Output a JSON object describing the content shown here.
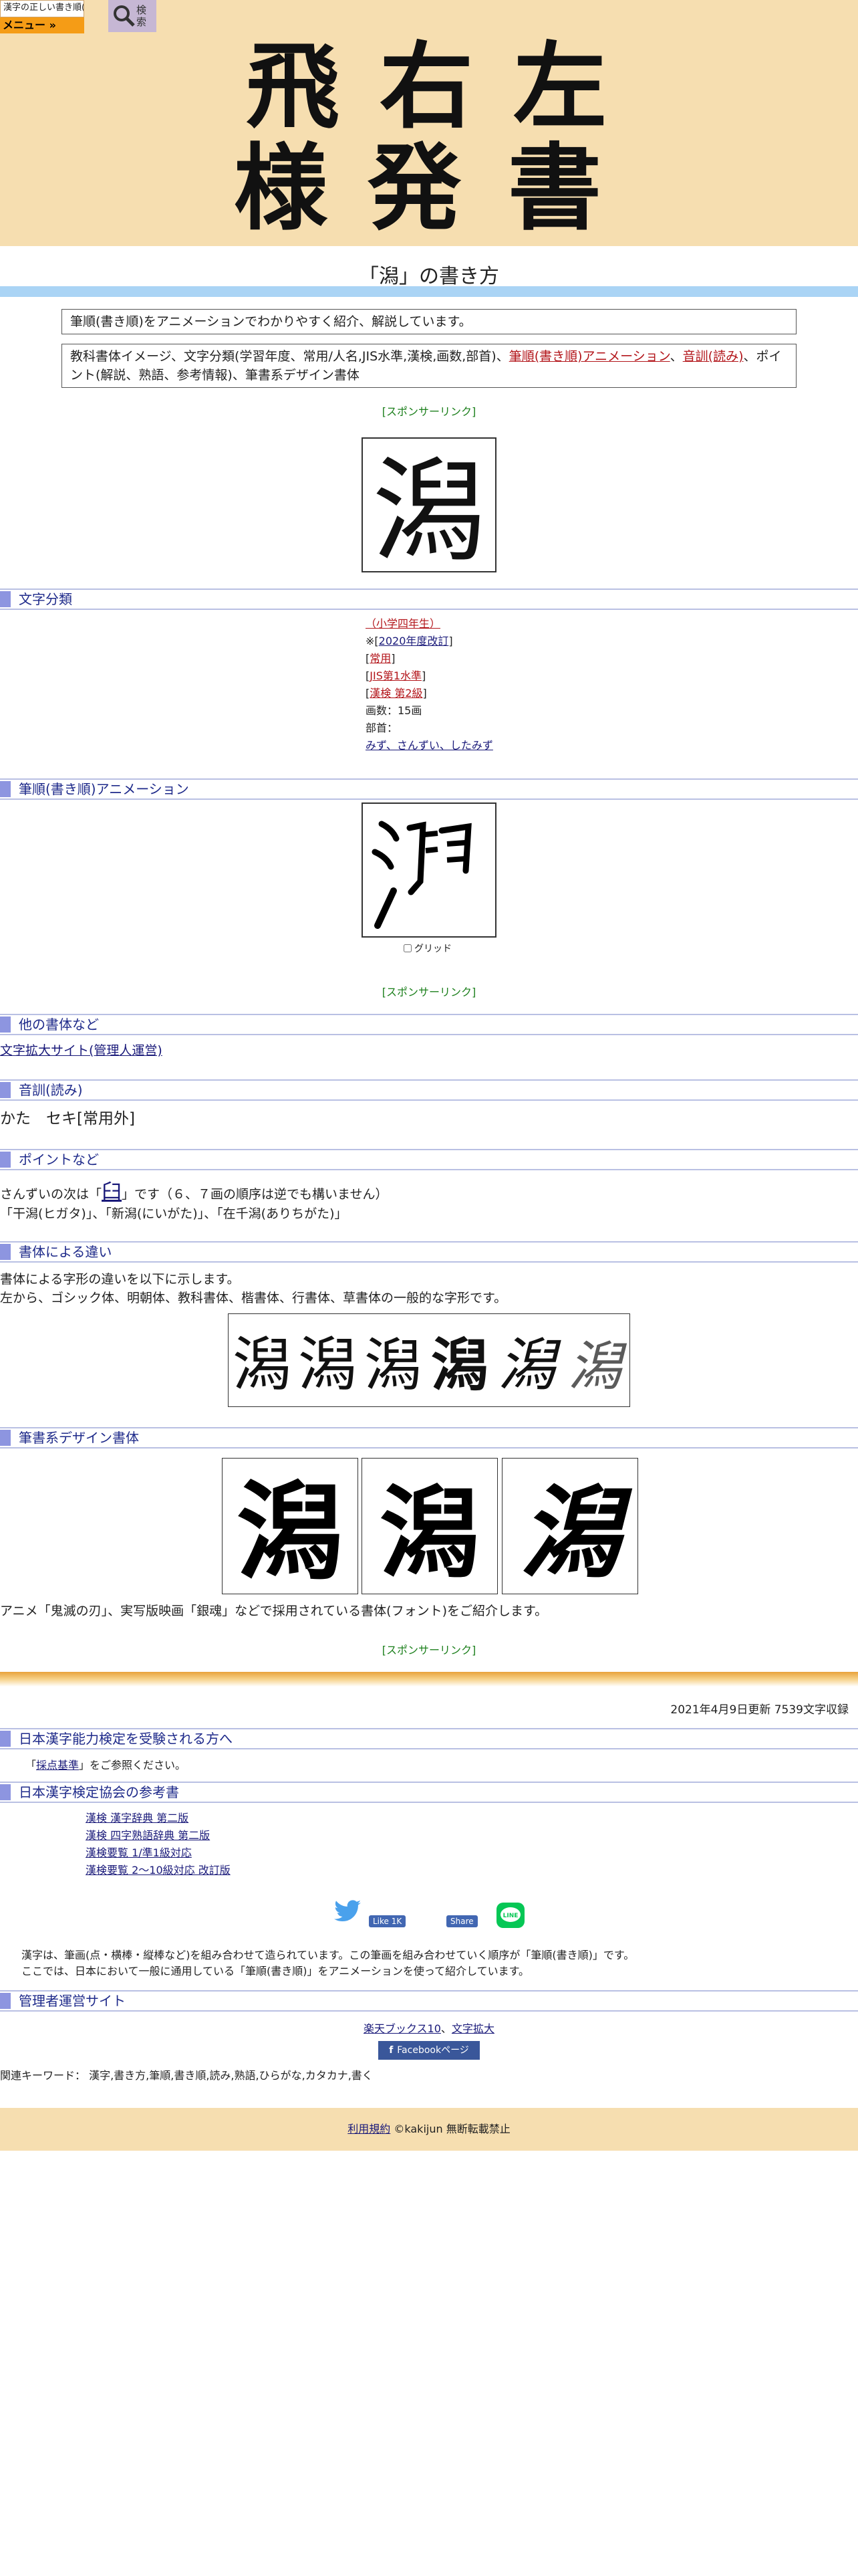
{
  "header": {
    "logo_top": "漢字の正しい書き順(筆順)",
    "menu_label": "メニュー »",
    "search_label": "検索",
    "hero_chars": [
      "飛",
      "右",
      "左",
      "様",
      "発",
      "書"
    ]
  },
  "title": "「潟」の書き方",
  "intro": "筆順(書き順)をアニメーションでわかりやすく紹介、解説しています。",
  "features": {
    "text1": "教科書体イメージ、文字分類(学習年度、常用/人名,JIS水準,漢検,画数,部首)、",
    "link1": "筆順(書き順)アニメーション",
    "sep1": "、",
    "link2": "音訓(読み)",
    "text2": "、ポイント(解説、熟語、参考情報)、筆書系デザイン書体"
  },
  "sponsor_label": "[スポンサーリンク]",
  "kanji": "潟",
  "sections": {
    "classification": "文字分類",
    "animation": "筆順(書き順)アニメーション",
    "other_fonts": "他の書体など",
    "reading": "音訓(読み)",
    "point": "ポイントなど",
    "font_diff": "書体による違い",
    "brush": "筆書系デザイン書体",
    "kanken": "日本漢字能力検定を受験される方へ",
    "kanken_ref": "日本漢字検定協会の参考書",
    "admin": "管理者運営サイト"
  },
  "classification": {
    "grade": "（小学四年生）",
    "revision_prefix": "※",
    "revision": "2020年度改訂",
    "joyo": "常用",
    "jis": "JIS第1水準",
    "kanken": "漢検 第2級",
    "strokes": "画数：15画",
    "radical_label": "部首：",
    "radical": "みず、さんずい、したみず"
  },
  "animation": {
    "grid_label": "グリッド"
  },
  "other_fonts_link": "文字拡大サイト(管理人運営)",
  "reading": "かた　セキ[常用外]",
  "point": {
    "line1_a": "さんずいの次は「",
    "line1_char": "臼",
    "line1_b": "」です（６、７画の順序は逆でも構いません）",
    "line2": "「干潟(ヒガタ)」、「新潟(にいがた)」、「在千潟(ありちがた)」"
  },
  "font_diff": {
    "line1": "書体による字形の違いを以下に示します。",
    "line2": "左から、ゴシック体、明朝体、教科書体、楷書体、行書体、草書体の一般的な字形です。"
  },
  "brush_caption": "アニメ「鬼滅の刃」、実写版映画「銀魂」などで採用されている書体(フォント)をご紹介します。",
  "update": "2021年4月9日更新 7539文字収録",
  "kanken": {
    "pre": "「",
    "link": "採点基準",
    "post": "」をご参照ください。"
  },
  "books": [
    "漢検 漢字辞典 第二版",
    "漢検 四字熟語辞典 第二版",
    "漢検要覧 1/準1級対応",
    "漢検要覧 2～10級対応 改訂版"
  ],
  "social": {
    "like": "Like 1K",
    "share": "Share",
    "line": "LINE"
  },
  "note": {
    "line1": "漢字は、筆画(点・横棒・縦棒など)を組み合わせて造られています。この筆画を組み合わせていく順序が「筆順(書き順)」です。",
    "line2": "ここでは、日本において一般に通用している「筆順(書き順)」をアニメーションを使って紹介しています。"
  },
  "admin_links": {
    "a": "楽天ブックス10",
    "sep": "、",
    "b": "文字拡大"
  },
  "fb_page": "Facebookページ",
  "keywords": "関連キーワード： 漢字,書き方,筆順,書き順,読み,熟語,ひらがな,カタカナ,書く",
  "footer": {
    "terms": "利用規約",
    "copy": "©kakijun 無断転載禁止"
  }
}
